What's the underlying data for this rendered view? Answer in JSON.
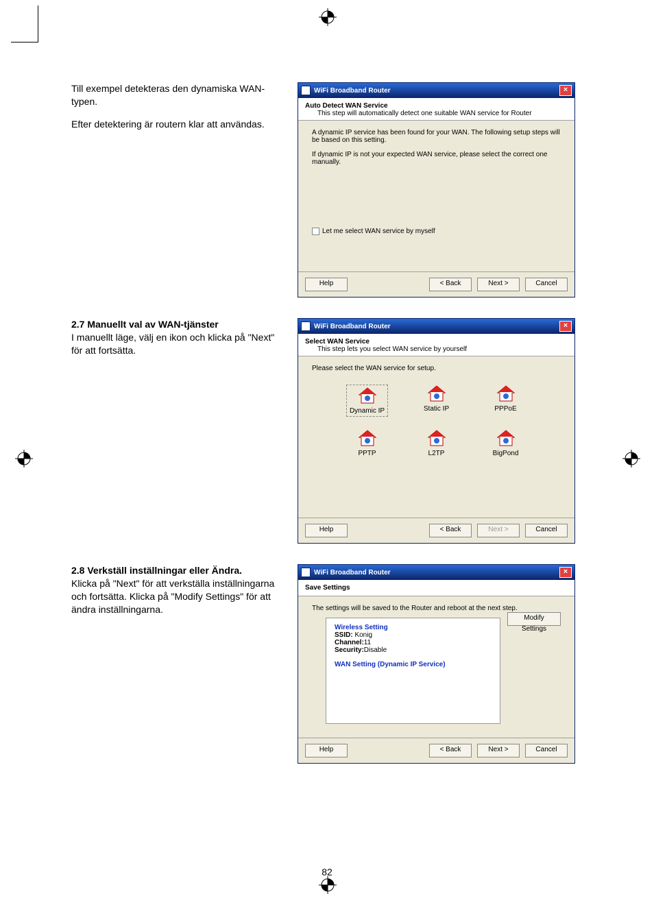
{
  "para1a": "Till exempel detekteras den dynamiska WAN-typen.",
  "para1b": "Efter detektering är routern klar att användas.",
  "head2": "2.7 Manuellt val av WAN-tjänster",
  "para2": "I manuellt läge, välj en ikon och klicka på \"Next\" för att fortsätta.",
  "head3": "2.8 Verkställ inställningar eller Ändra.",
  "para3": "Klicka på \"Next\" för att verkställa inställningarna och fortsätta. Klicka på \"Modify Settings\" för att ändra inställningarna.",
  "win": {
    "title": "WiFi Broadband Router",
    "help": "Help",
    "back": "< Back",
    "next": "Next >",
    "cancel": "Cancel"
  },
  "d1": {
    "h1": "Auto Detect WAN Service",
    "h2": "This step will automatically detect one suitable WAN service for Router",
    "b1": "A dynamic IP service has been found for your WAN. The following setup steps will be based on this setting.",
    "b2": "If dynamic IP is not your expected WAN service, please select the correct one manually.",
    "chk": "Let me select WAN service by myself"
  },
  "d2": {
    "h1": "Select WAN Service",
    "h2": "This step lets you select WAN service by yourself",
    "prompt": "Please select the WAN service for setup.",
    "svc": [
      "Dynamic IP",
      "Static IP",
      "PPPoE",
      "PPTP",
      "L2TP",
      "BigPond"
    ]
  },
  "d3": {
    "h1": "Save Settings",
    "b1": "The settings will be saved to the Router and reboot at the next step.",
    "wireless": "Wireless Setting",
    "ssidL": "SSID:",
    "ssidV": "Konig",
    "chL": "Channel:",
    "chV": "11",
    "secL": "Security:",
    "secV": "Disable",
    "wan": "WAN Setting  (Dynamic IP Service)",
    "modify": "Modify Settings"
  },
  "pagenum": "82"
}
